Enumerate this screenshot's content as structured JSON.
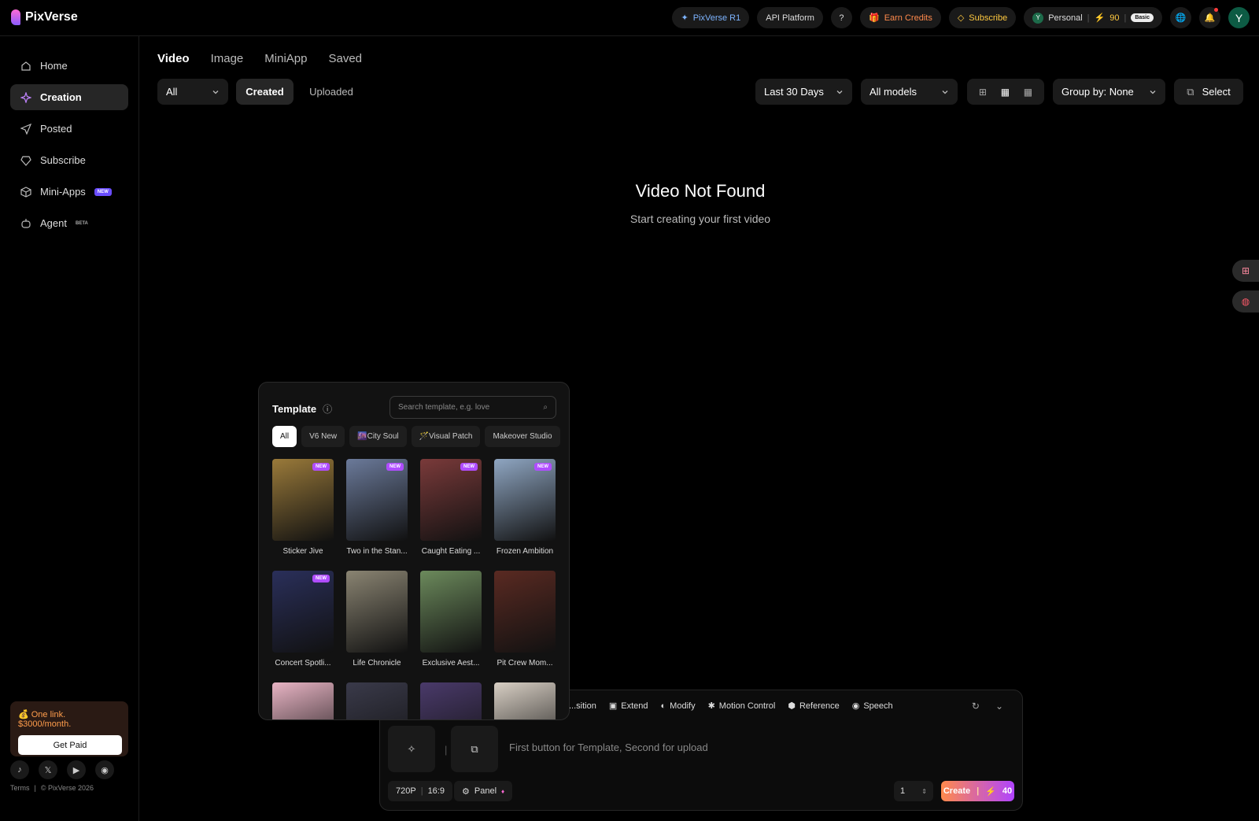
{
  "brand": {
    "name": "PixVerse"
  },
  "topbar": {
    "pixverse_r1": "PixVerse R1",
    "api_platform": "API Platform",
    "earn_credits": "Earn Credits",
    "subscribe": "Subscribe",
    "account": "Personal",
    "account_initial": "Y",
    "credits": "90",
    "plan": "Basic",
    "avatar_initial": "Y"
  },
  "sidebar": {
    "items": [
      {
        "label": "Home",
        "icon": "home-icon"
      },
      {
        "label": "Creation",
        "icon": "sparkle-icon"
      },
      {
        "label": "Posted",
        "icon": "send-icon"
      },
      {
        "label": "Subscribe",
        "icon": "diamond-icon"
      },
      {
        "label": "Mini-Apps",
        "icon": "cube-icon",
        "tag": "NEW"
      },
      {
        "label": "Agent",
        "icon": "robot-icon",
        "tag": "BETA"
      }
    ],
    "promo_text": "💰 One link. $3000/month.",
    "promo_button": "Get Paid",
    "terms": "Terms",
    "copyright": "© PixVerse 2026"
  },
  "tabs": [
    "Video",
    "Image",
    "MiniApp",
    "Saved"
  ],
  "filters": {
    "type": "All",
    "created": "Created",
    "uploaded": "Uploaded",
    "range": "Last 30 Days",
    "models": "All models",
    "group_by": "Group by: None",
    "select": "Select"
  },
  "empty": {
    "title": "Video Not Found",
    "subtitle": "Start creating your first video"
  },
  "template": {
    "title": "Template",
    "search_placeholder": "Search template, e.g. love",
    "tabs": [
      "All",
      "V6 New",
      "🌆City Soul",
      "🪄Visual Patch",
      "Makeover Studio"
    ],
    "new_badge": "NEW",
    "items": [
      {
        "title": "Sticker Jive",
        "new": true,
        "color": "#9a7a3a"
      },
      {
        "title": "Two in the Stan...",
        "new": true,
        "color": "#6b7a9a"
      },
      {
        "title": "Caught Eating ...",
        "new": true,
        "color": "#7a3a3a"
      },
      {
        "title": "Frozen Ambition",
        "new": true,
        "color": "#8fa6c2"
      },
      {
        "title": "Concert Spotli...",
        "new": true,
        "color": "#2a2f5a"
      },
      {
        "title": "Life Chronicle",
        "new": false,
        "color": "#8a8472"
      },
      {
        "title": "Exclusive Aest...",
        "new": false,
        "color": "#6c8a5c"
      },
      {
        "title": "Pit Crew Mom...",
        "new": false,
        "color": "#5a2a22"
      },
      {
        "title": "",
        "new": false,
        "color": "#e8b4c4"
      },
      {
        "title": "",
        "new": false,
        "color": "#3a3a4a"
      },
      {
        "title": "",
        "new": false,
        "color": "#4a3a6a"
      },
      {
        "title": "",
        "new": false,
        "color": "#d8cfc4"
      }
    ]
  },
  "composer": {
    "modes": [
      "...sition",
      "Extend",
      "Modify",
      "Motion Control",
      "Reference",
      "Speech"
    ],
    "placeholder": "First button for Template, Second for upload",
    "resolution": "720P",
    "ratio": "16:9",
    "panel": "Panel",
    "count": "1",
    "create": "Create",
    "cost": "40"
  },
  "colors": {
    "accent": "#b044ff",
    "orange": "#ff8a4c"
  }
}
